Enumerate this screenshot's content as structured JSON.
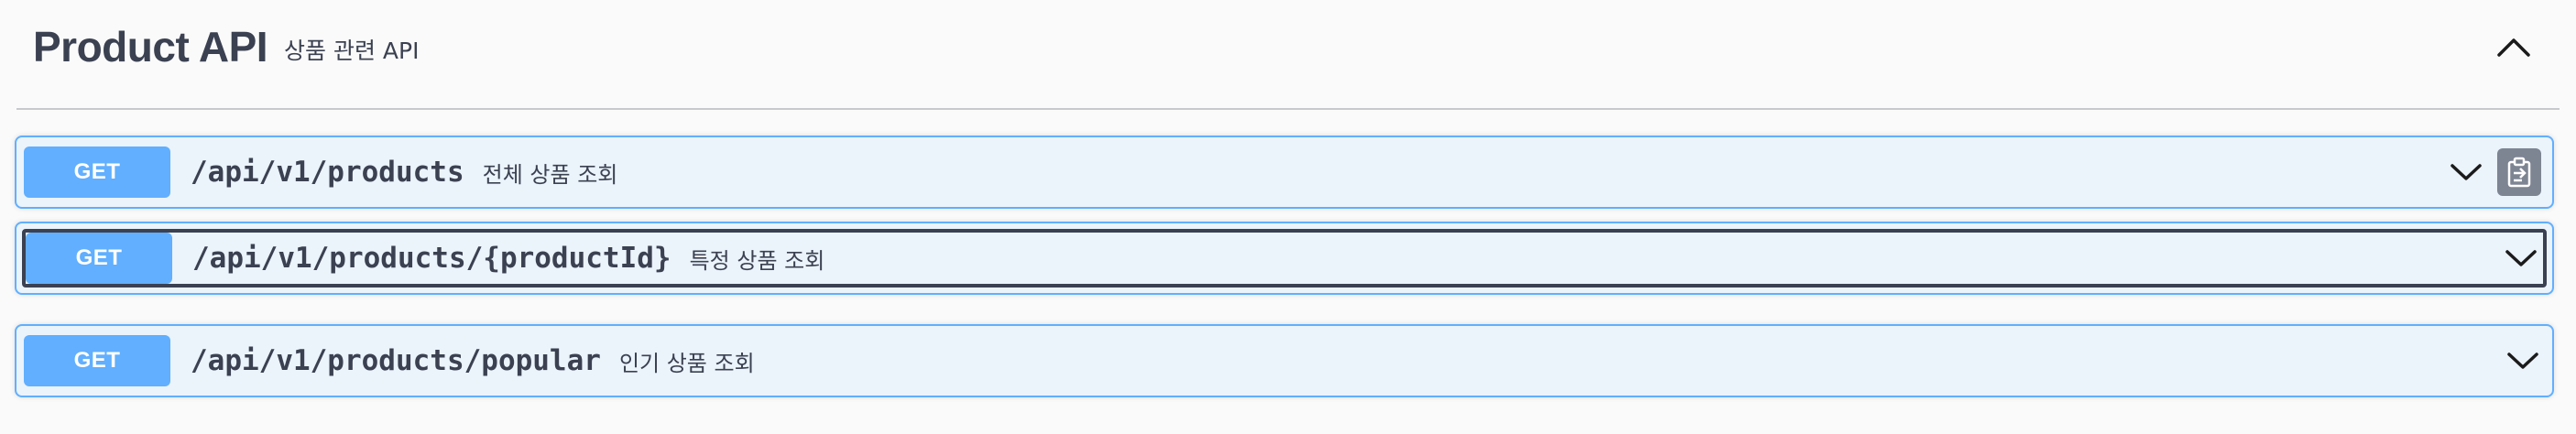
{
  "tag": {
    "title": "Product API",
    "description": "상품 관련 API",
    "collapse_icon": "chevron-up-icon"
  },
  "operations": [
    {
      "method": "GET",
      "path": "/api/v1/products",
      "summary": "전체 상품 조회",
      "has_copy_button": true,
      "focused": false
    },
    {
      "method": "GET",
      "path": "/api/v1/products/{productId}",
      "summary": "특정 상품 조회",
      "has_copy_button": false,
      "focused": true
    },
    {
      "method": "GET",
      "path": "/api/v1/products/popular",
      "summary": "인기 상품 조회",
      "has_copy_button": false,
      "focused": false
    }
  ],
  "colors": {
    "get_method": "#61affe",
    "opblock_bg": "#ebf3fb",
    "text": "#3b4151",
    "copy_button_bg": "#7d8492",
    "page_bg": "#fafafa"
  }
}
